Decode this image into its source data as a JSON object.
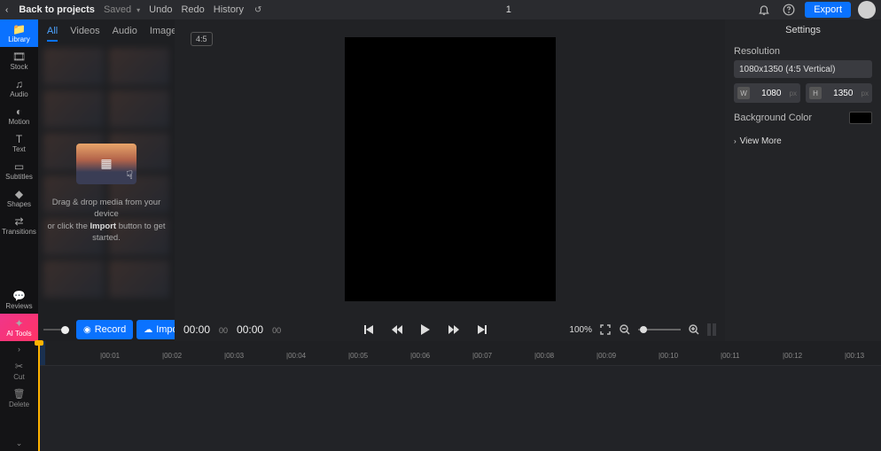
{
  "topbar": {
    "back_label": "Back to projects",
    "saved_label": "Saved",
    "undo_label": "Undo",
    "redo_label": "Redo",
    "history_label": "History",
    "title": "1",
    "export_label": "Export"
  },
  "nav": {
    "library": "Library",
    "stock": "Stock",
    "audio": "Audio",
    "motion": "Motion",
    "text": "Text",
    "subtitles": "Subtitles",
    "shapes": "Shapes",
    "transitions": "Transitions",
    "reviews": "Reviews",
    "ai_tools": "AI Tools"
  },
  "library": {
    "tabs": {
      "all": "All",
      "videos": "Videos",
      "audio": "Audio",
      "images": "Images"
    },
    "drop_line1": "Drag & drop media from your device",
    "drop_line2_pre": "or click the ",
    "drop_line2_bold": "Import",
    "drop_line2_post": " button to get started.",
    "record_label": "Record",
    "import_label": "Import"
  },
  "preview": {
    "ratio": "4:5",
    "time_current": "00:00",
    "time_current_frames": "00",
    "time_total": "00:00",
    "time_total_frames": "00",
    "zoom_label": "100%"
  },
  "settings": {
    "title": "Settings",
    "resolution_label": "Resolution",
    "resolution_value": "1080x1350 (4:5 Vertical)",
    "width_letter": "W",
    "width_value": "1080",
    "width_unit": "px",
    "height_letter": "H",
    "height_value": "1350",
    "height_unit": "px",
    "bg_label": "Background Color",
    "viewmore_label": "View More"
  },
  "timeline": {
    "tool_cut": "Cut",
    "tool_delete": "Delete",
    "ticks": [
      "|00:01",
      "|00:02",
      "|00:03",
      "|00:04",
      "|00:05",
      "|00:06",
      "|00:07",
      "|00:08",
      "|00:09",
      "|00:10",
      "|00:11",
      "|00:12",
      "|00:13"
    ]
  }
}
